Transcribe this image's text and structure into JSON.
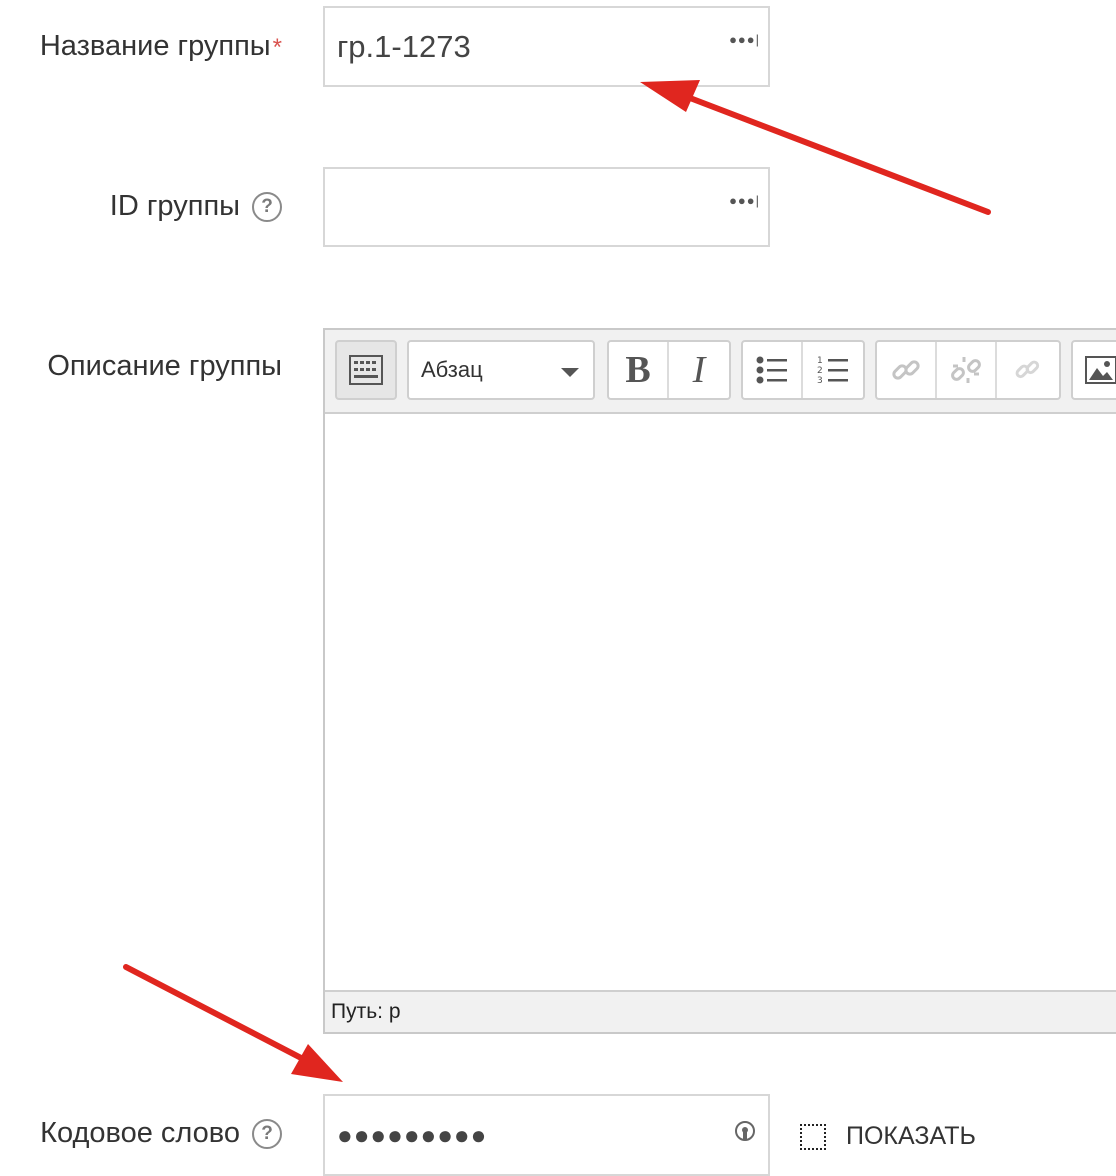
{
  "form": {
    "group_name": {
      "label": "Название группы",
      "required_mark": "*",
      "value": "гр.1-1273"
    },
    "group_id": {
      "label": "ID группы",
      "value": ""
    },
    "description": {
      "label": "Описание группы",
      "paragraph_select": "Абзац",
      "path_label": "Путь: р"
    },
    "password": {
      "label": "Кодовое слово",
      "value": "●●●●●●●●●",
      "show_label": "ПОКАЗАТЬ",
      "show_checked": false
    }
  },
  "colors": {
    "arrow": "#e0261f",
    "required": "#d9534f"
  }
}
